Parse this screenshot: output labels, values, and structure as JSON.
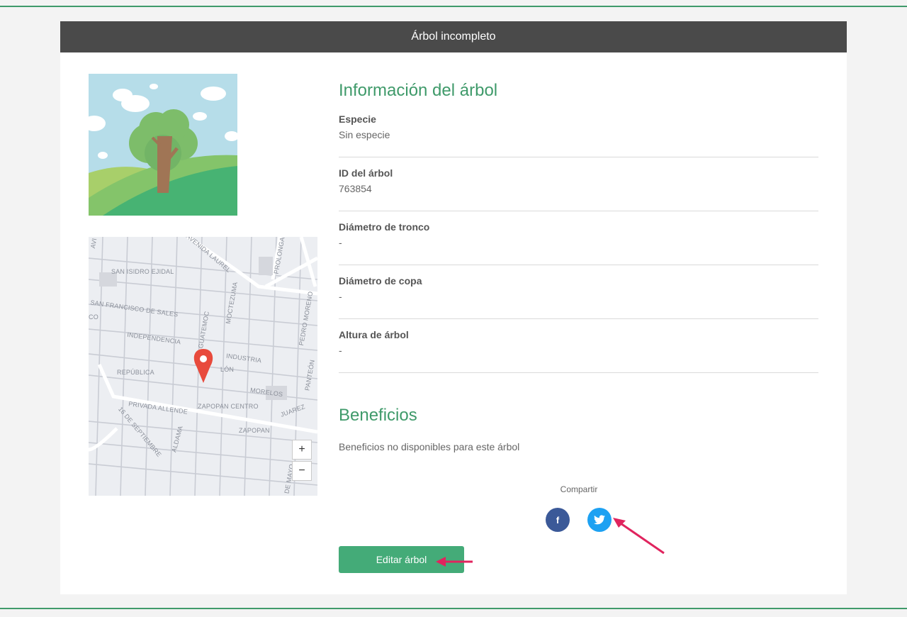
{
  "header": {
    "title": "Árbol incompleto"
  },
  "map": {
    "zoom_in": "+",
    "zoom_out": "−",
    "labels": {
      "san_isidro": "SAN ISIDRO EJIDAL",
      "san_francisco": "SAN FRANCISCO DE SALES",
      "co": "CO",
      "independencia": "INDEPENDENCIA",
      "industria": "INDUSTRIA",
      "republica": "REPÚBLICA",
      "morelos": "MORELOS",
      "privada_allende": "PRIVADA ALLENDE",
      "zapopan_centro": "ZAPOPAN CENTRO",
      "juarez": "JUAREZ",
      "zapopan": "ZAPOPAN",
      "septiembre": "16 DE SEPTIEMBRE",
      "aldama": "ALDAMA",
      "moctezuma": "MOCTEZUMA",
      "pedro_moreno": "PEDRO MORENO",
      "panteon": "PANTEÓN",
      "laureles": "AVENIDA LAUREL",
      "prolongacion": "PROLONGAC",
      "guatemoc": "GUATEMOC",
      "de_mayo": "DE MAYO",
      "lon": "LÓN",
      "avi": "AVI"
    }
  },
  "info": {
    "title": "Información del árbol",
    "fields": [
      {
        "label": "Especie",
        "value": "Sin especie"
      },
      {
        "label": "ID del árbol",
        "value": "763854"
      },
      {
        "label": "Diámetro de tronco",
        "value": "-"
      },
      {
        "label": "Diámetro de copa",
        "value": "-"
      },
      {
        "label": "Altura de árbol",
        "value": "-"
      }
    ]
  },
  "benefits": {
    "title": "Beneficios",
    "text": "Beneficios no disponibles para este árbol"
  },
  "share": {
    "label": "Compartir",
    "facebook_glyph": "f",
    "facebook_color": "#3b5998",
    "twitter_color": "#1da1f2"
  },
  "actions": {
    "edit_label": "Editar árbol"
  },
  "colors": {
    "accent": "#3f9a6a",
    "button": "#44ab78",
    "header_bg": "#4a4a4a",
    "annotation_arrow": "#e0245e"
  }
}
